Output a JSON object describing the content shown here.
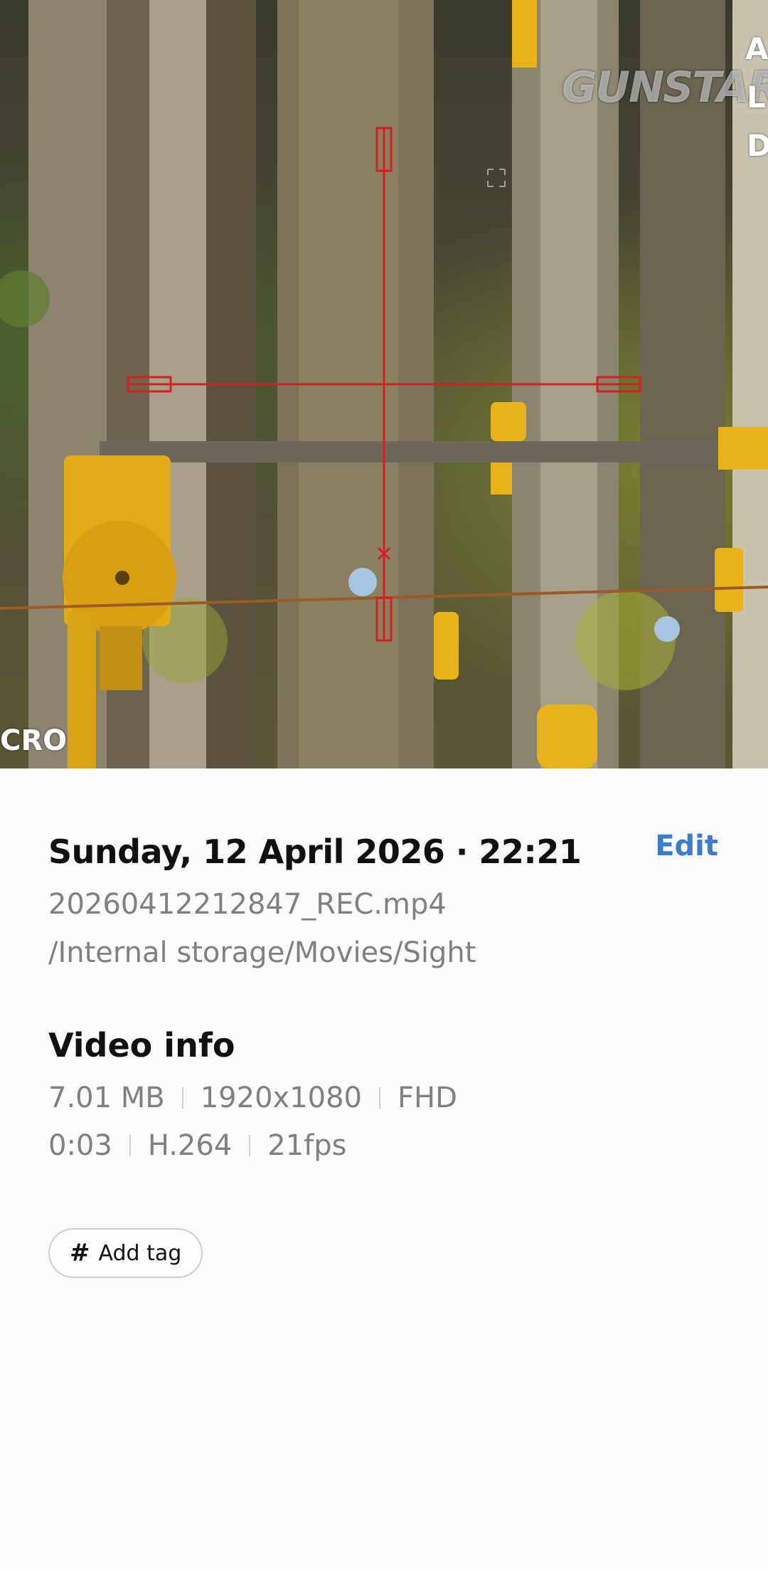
{
  "preview": {
    "watermark": "GUNSTAR",
    "side_letters": [
      "A",
      "L",
      "D"
    ],
    "corner_text": "CRO",
    "colors": {
      "reticle": "#d42020",
      "target_yellow": "#e8b21a"
    }
  },
  "details": {
    "datetime": "Sunday, 12 April 2026 · 22:21",
    "edit_label": "Edit",
    "filename": "20260412212847_REC.mp4",
    "path": "/Internal storage/Movies/Sight"
  },
  "video_info": {
    "title": "Video info",
    "size": "7.01 MB",
    "resolution": "1920x1080",
    "quality": "FHD",
    "duration": "0:03",
    "codec": "H.264",
    "fps": "21fps"
  },
  "tags": {
    "icon": "hash-icon",
    "add_label": "Add tag"
  },
  "colors": {
    "accent": "#3b7bd0",
    "secondary_text": "#808080"
  }
}
